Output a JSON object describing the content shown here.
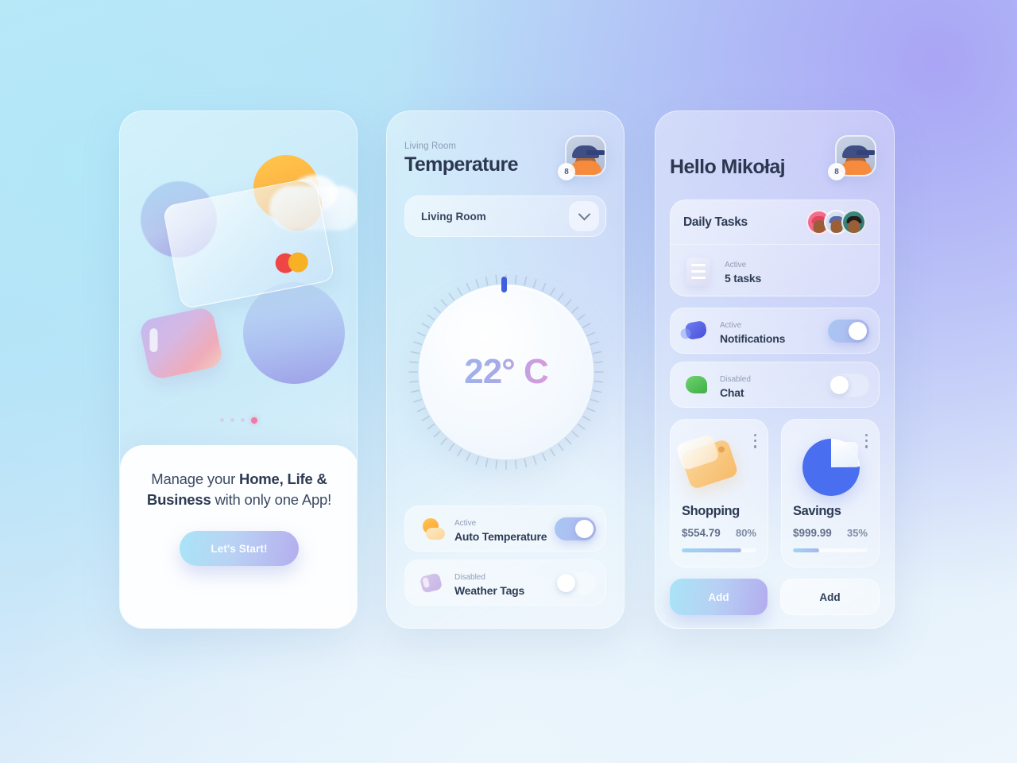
{
  "background": {
    "from": "#bfe7f8",
    "to": "#a8a2f5"
  },
  "screen1": {
    "headline_part1": "Manage your ",
    "headline_bold1": "Home, Life & Business",
    "headline_part2": " with only one App!",
    "cta_label": "Let's Start!",
    "pagination": {
      "total": 4,
      "active_index": 3
    },
    "accent_active_dot": "#ef7ba8"
  },
  "screen2": {
    "eyebrow": "Living Room",
    "title": "Temperature",
    "avatar": {
      "badge": "8",
      "name": "user-avatar"
    },
    "room_select": {
      "value": "Living Room",
      "icon": "chevron-down-icon"
    },
    "dial": {
      "value": "22° C",
      "ticks": 60,
      "indicator_position_deg": 0
    },
    "options": [
      {
        "state": "Active",
        "label": "Auto Temperature",
        "toggle": "on",
        "icon": "sun-cloud-icon"
      },
      {
        "state": "Disabled",
        "label": "Weather Tags",
        "toggle": "off",
        "icon": "tag-icon"
      }
    ]
  },
  "screen3": {
    "greeting": "Hello Mikołaj",
    "avatar": {
      "badge": "8",
      "name": "user-avatar"
    },
    "tasks": {
      "title": "Daily Tasks",
      "members": [
        "member-1",
        "member-2",
        "member-3"
      ],
      "state": "Active",
      "count_label": "5 tasks",
      "icon": "document-icon"
    },
    "options": [
      {
        "state": "Active",
        "label": "Notifications",
        "toggle": "on",
        "icon": "bell-icon"
      },
      {
        "state": "Disabled",
        "label": "Chat",
        "toggle": "off",
        "icon": "chat-icon"
      }
    ],
    "cards": [
      {
        "title": "Shopping",
        "amount": "$554.79",
        "percent": "80%",
        "progress": 80,
        "icon": "price-tag-icon",
        "menu": "kebab-menu-icon",
        "action": "Add",
        "action_style": "primary"
      },
      {
        "title": "Savings",
        "amount": "$999.99",
        "percent": "35%",
        "progress": 35,
        "icon": "pie-chart-icon",
        "menu": "kebab-menu-icon",
        "action": "Add",
        "action_style": "ghost"
      }
    ]
  }
}
